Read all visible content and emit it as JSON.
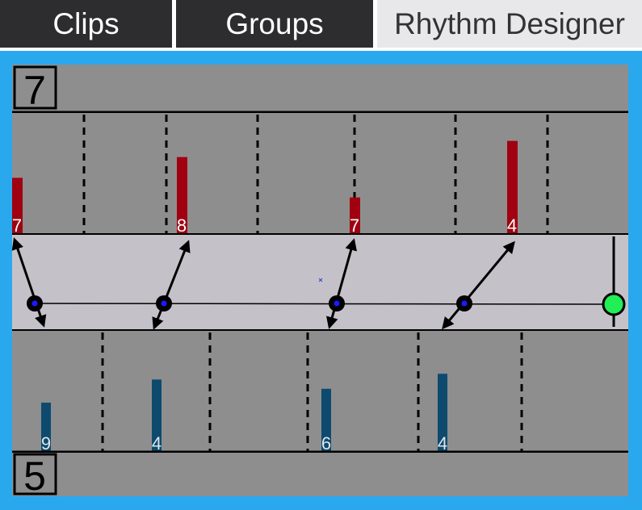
{
  "tabs": [
    {
      "label": "Clips",
      "selected": false
    },
    {
      "label": "Groups",
      "selected": false
    },
    {
      "label": "Rhythm Designer",
      "selected": true
    }
  ],
  "top_track": {
    "beat_count": "7",
    "color": "#a00010",
    "hits": [
      {
        "value": "7",
        "level": 0.48
      },
      {
        "value": "8",
        "level": 0.66
      },
      {
        "value": "7",
        "level": 0.31
      },
      {
        "value": "4",
        "level": 0.8
      }
    ]
  },
  "bottom_track": {
    "beat_count": "5",
    "color": "#0e4a6e",
    "hits": [
      {
        "value": "9",
        "level": 0.42
      },
      {
        "value": "4",
        "level": 0.62
      },
      {
        "value": "6",
        "level": 0.54
      },
      {
        "value": "4",
        "level": 0.67
      }
    ]
  },
  "colors": {
    "accent_frame": "#2aa8ee",
    "panel": "#8e8e8e",
    "middle_band": "#c4c2c8",
    "playhead": "#22ee55"
  }
}
